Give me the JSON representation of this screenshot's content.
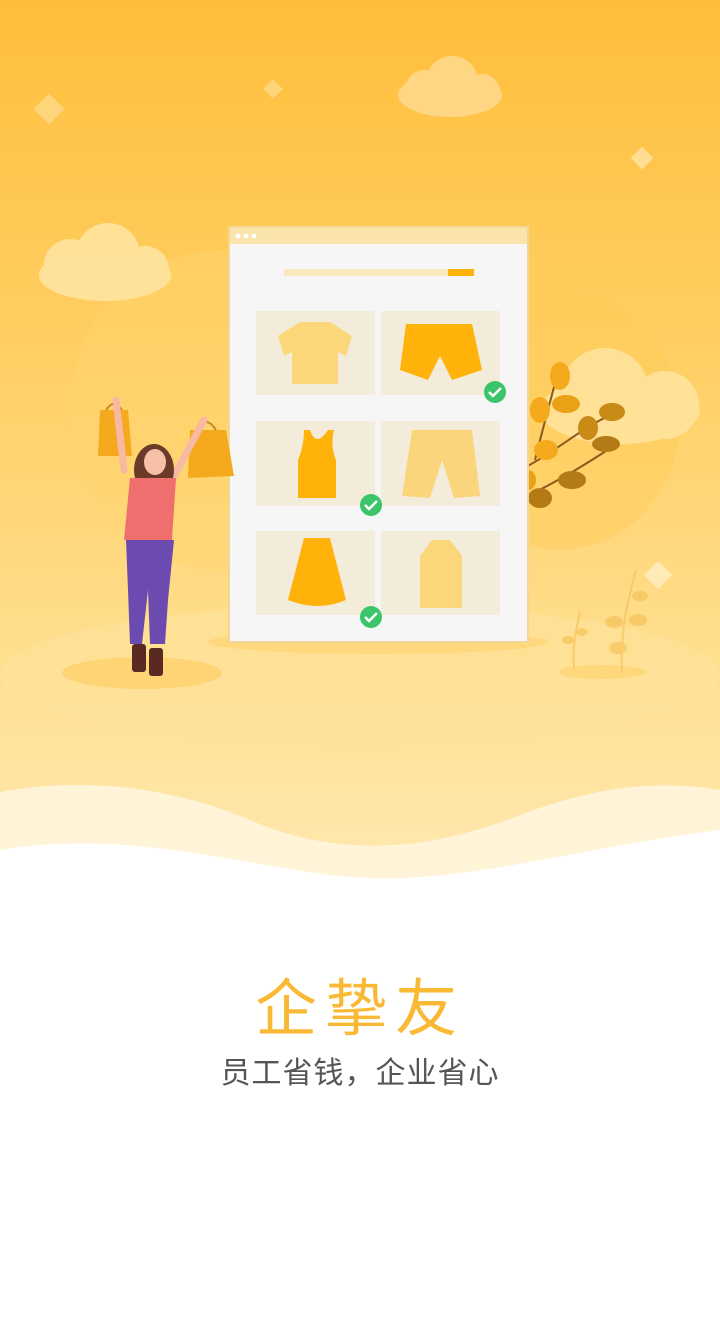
{
  "splash": {
    "app_name": "企挚友",
    "tagline": "员工省钱，企业省心"
  },
  "colors": {
    "brand": "#f9b934",
    "tagline": "#555555",
    "check": "#3cc46a"
  },
  "illustration": {
    "checked_items": [
      "shorts",
      "tank-top",
      "skirt"
    ]
  }
}
